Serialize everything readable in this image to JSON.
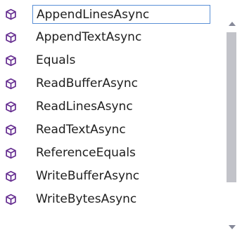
{
  "completion_list": {
    "items": [
      {
        "label": "AppendLinesAsync",
        "icon": "method-cube-icon",
        "selected": true
      },
      {
        "label": "AppendTextAsync",
        "icon": "method-cube-icon",
        "selected": false
      },
      {
        "label": "Equals",
        "icon": "method-cube-icon",
        "selected": false
      },
      {
        "label": "ReadBufferAsync",
        "icon": "method-cube-icon",
        "selected": false
      },
      {
        "label": "ReadLinesAsync",
        "icon": "method-cube-icon",
        "selected": false
      },
      {
        "label": "ReadTextAsync",
        "icon": "method-cube-icon",
        "selected": false
      },
      {
        "label": "ReferenceEquals",
        "icon": "method-cube-icon",
        "selected": false
      },
      {
        "label": "WriteBufferAsync",
        "icon": "method-cube-icon",
        "selected": false
      },
      {
        "label": "WriteBytesAsync",
        "icon": "method-cube-icon",
        "selected": false
      }
    ]
  },
  "colors": {
    "icon_purple": "#652d90",
    "selection_border": "#5a8fd6",
    "text": "#1e1e1e",
    "scroll_thumb": "#c2c3c9",
    "scroll_arrow": "#868999"
  }
}
